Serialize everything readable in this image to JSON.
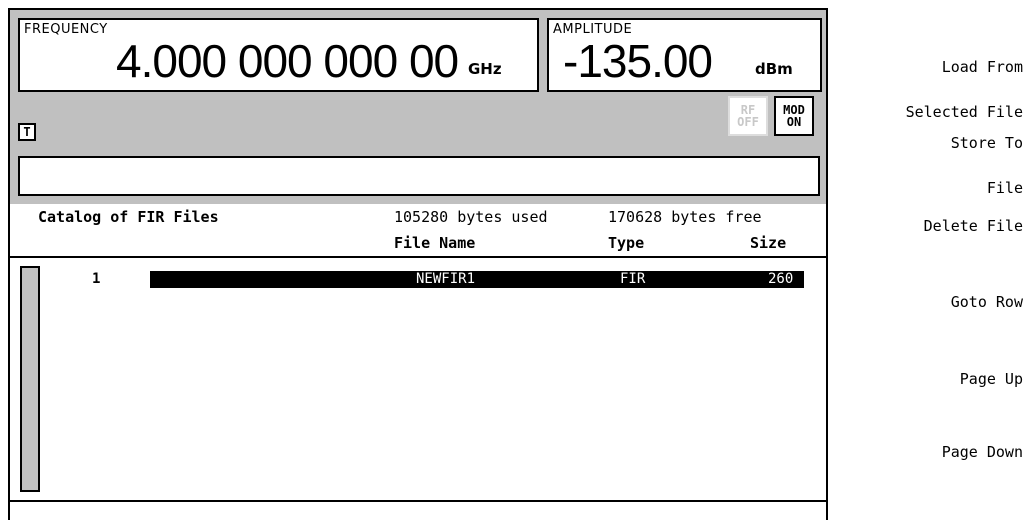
{
  "frequency": {
    "label": "FREQUENCY",
    "value": "4.000 000 000 00",
    "unit": "GHz"
  },
  "amplitude": {
    "label": "AMPLITUDE",
    "value": "-135.00",
    "unit": "dBm"
  },
  "flags": {
    "t": "T",
    "rf_line1": "RF",
    "rf_line2": "OFF",
    "mod_line1": "MOD",
    "mod_line2": "ON"
  },
  "message": "",
  "catalog": {
    "title": "Catalog of FIR Files",
    "bytes_used": "105280 bytes used",
    "bytes_free": "170628 bytes free",
    "columns": {
      "name": "File Name",
      "type": "Type",
      "size": "Size"
    },
    "rows": [
      {
        "index": "1",
        "name": "NEWFIR1",
        "type": "FIR",
        "size": "260"
      }
    ]
  },
  "softkeys": [
    {
      "line1": "Load From",
      "line2": "Selected File"
    },
    {
      "line1": "Store To",
      "line2": "File"
    },
    {
      "line1": "Delete File",
      "line2": ""
    },
    {
      "line1": "Goto Row",
      "line2": ""
    },
    {
      "line1": "Page Up",
      "line2": ""
    },
    {
      "line1": "Page Down",
      "line2": ""
    }
  ],
  "colors": {
    "panel_gray": "#c0c0c0",
    "highlight": "#000000",
    "background": "#ffffff"
  }
}
